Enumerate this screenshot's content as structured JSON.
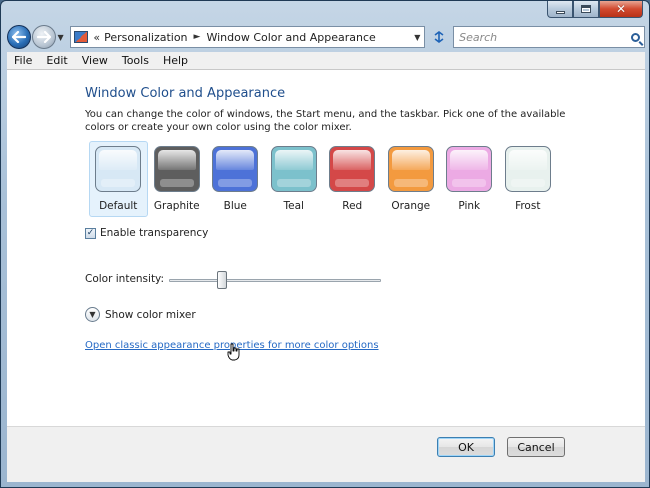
{
  "window": {
    "caption": {
      "minimize": "minimize",
      "maximize": "maximize",
      "close": "close"
    }
  },
  "nav": {
    "address": {
      "chevron": "«",
      "crumbs": [
        "Personalization",
        "Window Color and Appearance"
      ],
      "separator": "►"
    },
    "search": {
      "placeholder": "Search"
    }
  },
  "menubar": {
    "items": [
      "File",
      "Edit",
      "View",
      "Tools",
      "Help"
    ]
  },
  "content": {
    "title": "Window Color and Appearance",
    "description": "You can change the color of windows, the Start menu, and the taskbar. Pick one of the available colors or create your own color using the color mixer.",
    "swatches": [
      {
        "label": "Default",
        "color": "#d7e8f5",
        "selected": true
      },
      {
        "label": "Graphite",
        "color": "#5e5e5e",
        "selected": false
      },
      {
        "label": "Blue",
        "color": "#4d72d8",
        "selected": false
      },
      {
        "label": "Teal",
        "color": "#7cc1cc",
        "selected": false
      },
      {
        "label": "Red",
        "color": "#d44848",
        "selected": false
      },
      {
        "label": "Orange",
        "color": "#f39a3f",
        "selected": false
      },
      {
        "label": "Pink",
        "color": "#ecaae4",
        "selected": false
      },
      {
        "label": "Frost",
        "color": "#e8f1ee",
        "selected": false
      }
    ],
    "transparency": {
      "label": "Enable transparency",
      "checked": true
    },
    "intensity": {
      "label": "Color intensity:",
      "value_fraction": 0.24
    },
    "mixer": {
      "label": "Show color mixer"
    },
    "classic_link": "Open classic appearance properties for more color options"
  },
  "footer": {
    "ok": "OK",
    "cancel": "Cancel"
  }
}
